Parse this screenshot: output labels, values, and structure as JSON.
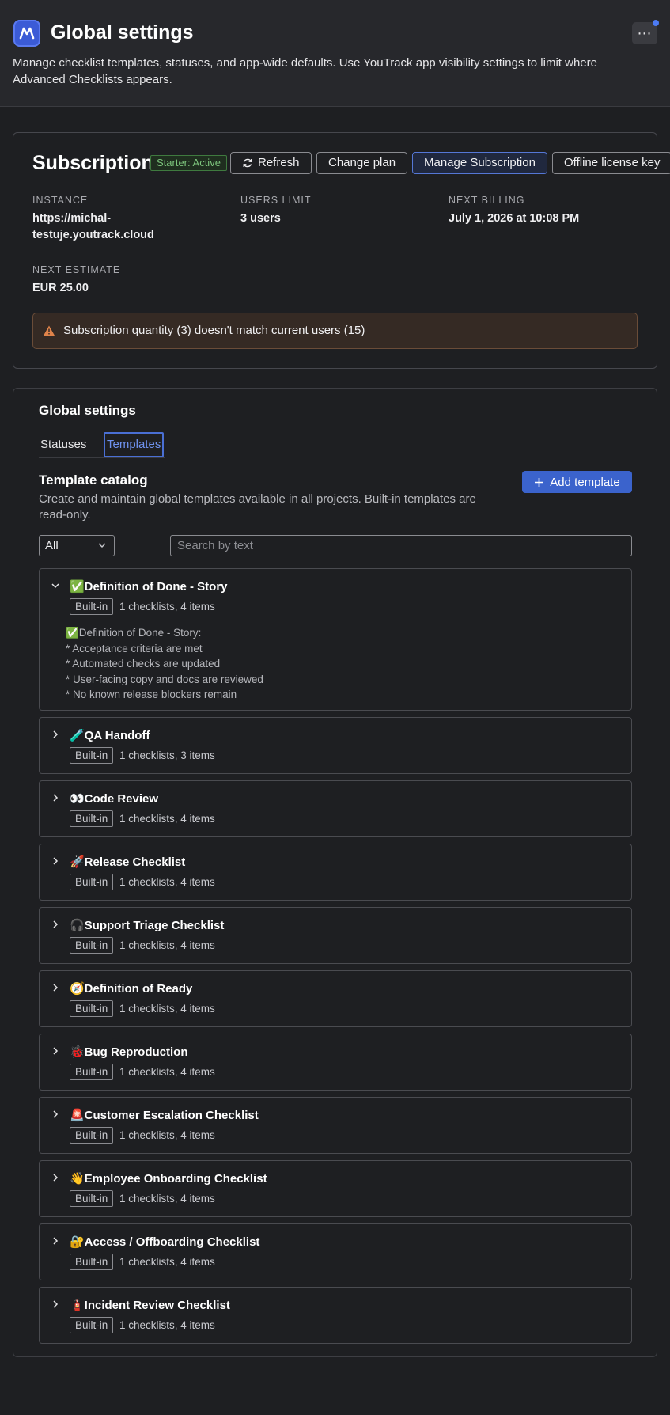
{
  "header": {
    "title": "Global settings",
    "description": "Manage checklist templates, statuses, and app-wide defaults. Use YouTrack app visibility settings to limit where Advanced Checklists appears.",
    "more_label": "⋯"
  },
  "subscription": {
    "title": "Subscription",
    "status": "Starter: Active",
    "buttons": {
      "refresh": "Refresh",
      "change_plan": "Change plan",
      "manage": "Manage Subscription",
      "offline": "Offline license key"
    },
    "fields": {
      "instance_label": "INSTANCE",
      "instance_value_line1": "https://michal-",
      "instance_value_line2": "testuje.youtrack.cloud",
      "users_label": "USERS LIMIT",
      "users_value": "3 users",
      "billing_label": "NEXT BILLING",
      "billing_value": "July 1, 2026 at 10:08 PM",
      "estimate_label": "NEXT ESTIMATE",
      "estimate_value": "EUR 25.00"
    },
    "warning": "Subscription quantity (3) doesn't match current users (15)"
  },
  "global": {
    "title": "Global settings",
    "tabs": [
      "Statuses",
      "Templates"
    ],
    "active_tab": "Templates",
    "catalog_title": "Template catalog",
    "catalog_desc": "Create and maintain global templates available in all projects. Built-in templates are read-only.",
    "add_button": "Add template",
    "filter_value": "All",
    "search_placeholder": "Search by text"
  },
  "templates": [
    {
      "name": "✅Definition of Done - Story",
      "badge": "Built-in",
      "counts": "1 checklists, 4 items",
      "expanded": true,
      "preview": [
        "✅Definition of Done - Story:",
        "* Acceptance criteria are met",
        "* Automated checks are updated",
        "* User-facing copy and docs are reviewed",
        "* No known release blockers remain"
      ]
    },
    {
      "name": "🧪QA Handoff",
      "badge": "Built-in",
      "counts": "1 checklists, 3 items"
    },
    {
      "name": "👀Code Review",
      "badge": "Built-in",
      "counts": "1 checklists, 4 items"
    },
    {
      "name": "🚀Release Checklist",
      "badge": "Built-in",
      "counts": "1 checklists, 4 items"
    },
    {
      "name": "🎧Support Triage Checklist",
      "badge": "Built-in",
      "counts": "1 checklists, 4 items"
    },
    {
      "name": "🧭Definition of Ready",
      "badge": "Built-in",
      "counts": "1 checklists, 4 items"
    },
    {
      "name": "🐞Bug Reproduction",
      "badge": "Built-in",
      "counts": "1 checklists, 4 items"
    },
    {
      "name": "🚨Customer Escalation Checklist",
      "badge": "Built-in",
      "counts": "1 checklists, 4 items"
    },
    {
      "name": "👋Employee Onboarding Checklist",
      "badge": "Built-in",
      "counts": "1 checklists, 4 items"
    },
    {
      "name": "🔐Access / Offboarding Checklist",
      "badge": "Built-in",
      "counts": "1 checklists, 4 items"
    },
    {
      "name": "🧯Incident Review Checklist",
      "badge": "Built-in",
      "counts": "1 checklists, 4 items"
    }
  ],
  "colors": {
    "accent": "#3b63cc",
    "background": "#1e1f22",
    "warning_bg": "#352a24",
    "status_green": "#7cc47c"
  }
}
